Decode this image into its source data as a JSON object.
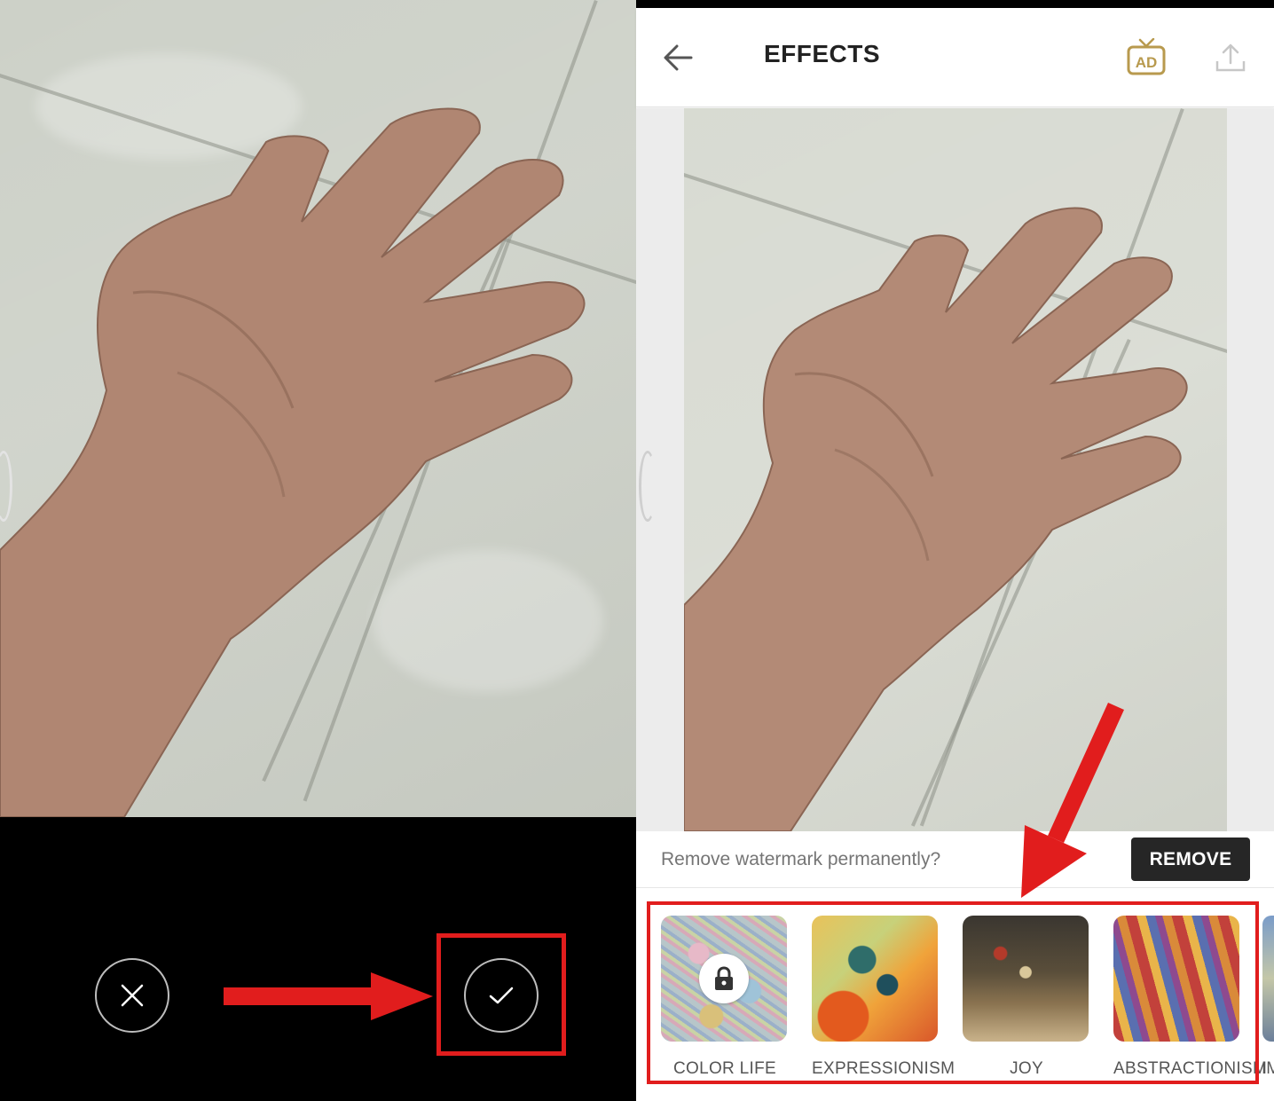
{
  "left_screen": {
    "cancel_button": "cancel",
    "confirm_button": "confirm",
    "annotation_color": "#e11d1d"
  },
  "right_screen": {
    "header": {
      "title": "EFFECTS",
      "back_icon": "arrow-left-icon",
      "ad_icon": "ad-tv-icon",
      "ad_label": "AD",
      "share_icon": "upload-icon"
    },
    "watermark_bar": {
      "text": "Remove watermark permanently?",
      "button_label": "REMOVE"
    },
    "effects": [
      {
        "label": "COLOR LIFE",
        "locked": true
      },
      {
        "label": "EXPRESSIONISM",
        "locked": false
      },
      {
        "label": "JOY",
        "locked": false
      },
      {
        "label": "ABSTRACTIONISM",
        "locked": false
      }
    ],
    "partial_effect_label": "IM",
    "accent_colors": {
      "ad_icon": "#b89a4e",
      "annotation": "#e11d1d",
      "remove_button": "#262626"
    }
  }
}
